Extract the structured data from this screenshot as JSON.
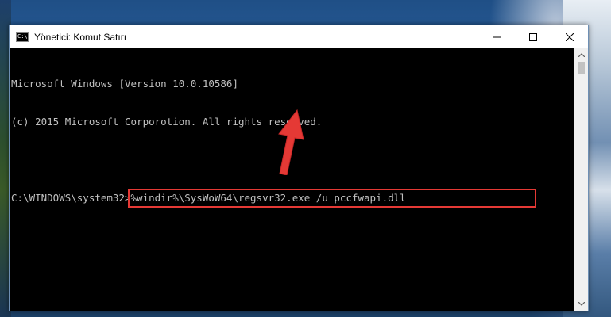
{
  "window": {
    "title": "Yönetici: Komut Satırı",
    "icon_label": "C:\\"
  },
  "console": {
    "lines": [
      "Microsoft Windows [Version 10.0.10586]",
      "(c) 2015 Microsoft Corporotion. All rights reserved.",
      ""
    ],
    "prompt": "C:\\WINDOWS\\system32>",
    "command": "%windir%\\SysWoW64\\regsvr32.exe /u pccfwapi.dll"
  },
  "colors": {
    "console_bg": "#000000",
    "console_text": "#c0c0c0",
    "highlight": "#e53935",
    "arrow": "#e53935"
  },
  "icons": {
    "minimize": "minimize-icon",
    "maximize": "maximize-icon",
    "close": "close-icon",
    "annotation_arrow": "arrow-up-icon"
  }
}
